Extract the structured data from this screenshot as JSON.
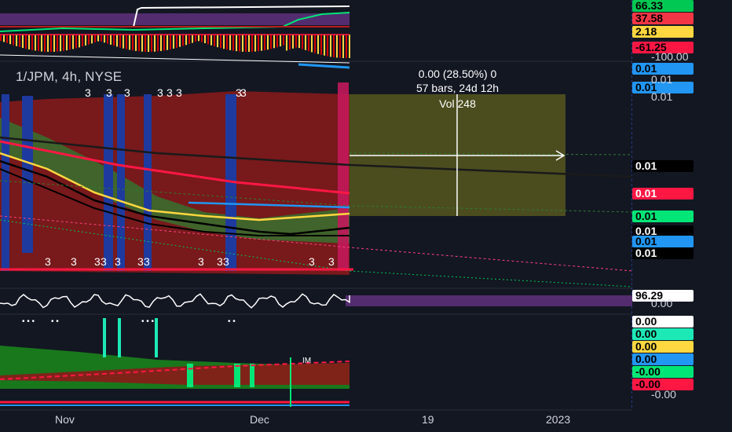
{
  "symbol": {
    "label": "1/JPM, 4h, NYSE"
  },
  "measure": {
    "change": "0.00 (28.50%) 0",
    "range": "57 bars, 24d 12h",
    "volume": "Vol 248"
  },
  "price_tags": [
    {
      "value": "66.33",
      "bg": "#00c853",
      "fg": "#000000",
      "top": 0
    },
    {
      "value": "37.58",
      "bg": "#f23645",
      "fg": "#000000",
      "top": 16
    },
    {
      "value": "2.18",
      "bg": "#ffd740",
      "fg": "#000000",
      "top": 33
    },
    {
      "value": "-61.25",
      "bg": "#ff1744",
      "fg": "#000000",
      "top": 53
    },
    {
      "value": "0.01",
      "bg": "#2196f3",
      "fg": "#000000",
      "top": 80
    },
    {
      "value": "0.01",
      "bg": "#2196f3",
      "fg": "#000000",
      "top": 104
    },
    {
      "value": "0.01",
      "bg": "#000000",
      "fg": "#ffffff",
      "top": 204
    },
    {
      "value": "0.01",
      "bg": "#ff1744",
      "fg": "#ffffff",
      "top": 239
    },
    {
      "value": "0.01",
      "bg": "#00e676",
      "fg": "#000000",
      "top": 268
    },
    {
      "value": "0.01",
      "bg": "#000000",
      "fg": "#ffffff",
      "top": 287
    },
    {
      "value": "0.01",
      "bg": "#2196f3",
      "fg": "#000000",
      "top": 300
    },
    {
      "value": "0.01",
      "bg": "#000000",
      "fg": "#ffffff",
      "top": 315
    },
    {
      "value": "96.29",
      "bg": "#ffffff",
      "fg": "#000000",
      "top": 369
    },
    {
      "value": "0.00",
      "bg": "#ffffff",
      "fg": "#000000",
      "top": 402
    },
    {
      "value": "0.00",
      "bg": "#1de9b6",
      "fg": "#000000",
      "top": 418
    },
    {
      "value": "0.00",
      "bg": "#ffd740",
      "fg": "#000000",
      "top": 434
    },
    {
      "value": "0.00",
      "bg": "#2196f3",
      "fg": "#000000",
      "top": 450
    },
    {
      "value": "-0.00",
      "bg": "#00e676",
      "fg": "#000000",
      "top": 466
    },
    {
      "value": "-0.00",
      "bg": "#ff1744",
      "fg": "#000000",
      "top": 482
    }
  ],
  "plain_values": [
    {
      "value": "-100.00",
      "top": 64
    },
    {
      "value": "0.01",
      "top": 93
    },
    {
      "value": "0.01",
      "top": 115
    },
    {
      "value": "0.00",
      "top": 378
    },
    {
      "value": "-0.00",
      "top": 494
    }
  ],
  "chart_data": {
    "type": "line",
    "x_ticks": [
      "Nov",
      "Dec",
      "19",
      "2023"
    ],
    "main_price_axis": [
      "0.01"
    ],
    "oscillator_value": "96.29",
    "markers": [
      "3",
      "3",
      "3",
      "3",
      "3",
      "3",
      "3",
      "3",
      "3",
      "3",
      "3",
      "3",
      "3",
      "3",
      "3",
      "3",
      "3",
      "3",
      "3",
      "3"
    ]
  },
  "marker_text": "3"
}
